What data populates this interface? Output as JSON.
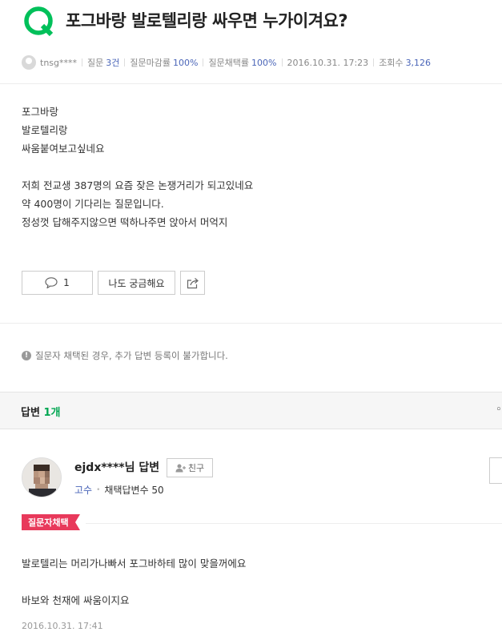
{
  "question": {
    "title": "포그바랑 발로텔리랑 싸우면 누가이겨요?",
    "author": "tnsg****",
    "questions_label": "질문",
    "questions_count": "3건",
    "deadline_rate_label": "질문마감률",
    "deadline_rate": "100%",
    "adopt_rate_label": "질문채택률",
    "adopt_rate": "100%",
    "datetime": "2016.10.31. 17:23",
    "views_label": "조회수",
    "views": "3,126",
    "body_lines": [
      "포그바랑",
      "발로텔리랑",
      "싸움붙여보고싶네요",
      "",
      "저희 전교생 387명의 요즘 잦은 논쟁거리가 되고있네요",
      "약 400명이 기다리는 질문입니다.",
      "정성껏 답해주지않으면 떡하나주면 앉아서 머억지"
    ]
  },
  "actions": {
    "comment_count": "1",
    "curious_label": "나도 궁금해요"
  },
  "notice": "질문자 채택된 경우, 추가 답변 등록이 불가합니다.",
  "answers": {
    "label": "답변",
    "count": "1개"
  },
  "answer": {
    "name": "ejdx****님 답변",
    "friend_label": "친구",
    "rank": "고수",
    "adopted_label": "채택답변수 50",
    "badge": "질문자채택",
    "lines": [
      "발로텔리는 머리가나빠서 포그바하테 많이 맞을꺼에요",
      "",
      "바보와 천재에 싸움이지요"
    ],
    "date": "2016.10.31. 17:41"
  },
  "colors": {
    "brand_green": "#00a651",
    "accent_blue": "#4a65b8",
    "badge_red": "#e8395b"
  }
}
